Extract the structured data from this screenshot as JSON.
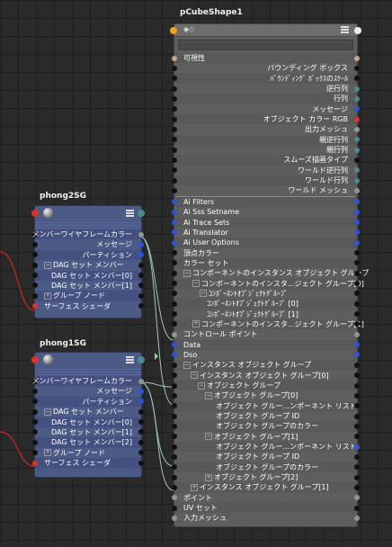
{
  "pcube": {
    "title": "pCubeShape1",
    "rows": [
      {
        "label": "可視性",
        "align": "l",
        "lp": "tan",
        "rp": "tan",
        "band": true
      },
      {
        "label": "バウンディング ボックス",
        "align": "r",
        "lp": "",
        "rp": "",
        "band": false
      },
      {
        "label": "ﾊﾞｳﾝﾃﾞｨﾝｸﾞ ﾎﾞｯｸｽのｽｹｰﾙ",
        "align": "r",
        "lp": "",
        "rp": "",
        "band": true
      },
      {
        "label": "逆行列",
        "align": "r",
        "lp": "",
        "rp": "teal",
        "band": false
      },
      {
        "label": "行列",
        "align": "r",
        "lp": "",
        "rp": "teal",
        "band": true
      },
      {
        "label": "メッセージ",
        "align": "r",
        "lp": "",
        "rp": "blue",
        "band": false
      },
      {
        "label": "オブジェクト カラー RGB",
        "align": "r",
        "lp": "",
        "rp": "red",
        "band": true
      },
      {
        "label": "出力メッシュ",
        "align": "r",
        "lp": "",
        "rp": "gray",
        "band": false
      },
      {
        "label": "親逆行列",
        "align": "r",
        "lp": "",
        "rp": "teal",
        "band": true
      },
      {
        "label": "親行列",
        "align": "r",
        "lp": "",
        "rp": "teal",
        "band": false
      },
      {
        "label": "スムーズ描画タイプ",
        "align": "r",
        "lp": "",
        "rp": "",
        "band": true
      },
      {
        "label": "ワールド逆行列",
        "align": "r",
        "lp": "",
        "rp": "teal",
        "band": false
      },
      {
        "label": "ワールド行列",
        "align": "r",
        "lp": "",
        "rp": "teal",
        "band": true
      },
      {
        "label": "ワールド メッシュ",
        "align": "r",
        "lp": "",
        "rp": "gray",
        "band": false
      },
      {
        "label": "Ai Filters",
        "align": "l",
        "lp": "blue",
        "rp": "blue",
        "band": true,
        "sep": true
      },
      {
        "label": "Ai Sss Setname",
        "align": "l",
        "lp": "blue",
        "rp": "blue",
        "band": false
      },
      {
        "label": "Ai Trace Sets",
        "align": "l",
        "lp": "blue",
        "rp": "blue",
        "band": true
      },
      {
        "label": "Ai Translator",
        "align": "l",
        "lp": "blue",
        "rp": "blue",
        "band": false
      },
      {
        "label": "Ai User Options",
        "align": "l",
        "lp": "blue",
        "rp": "blue",
        "band": true
      },
      {
        "label": "頂点カラー",
        "align": "l",
        "lp": "",
        "rp": "",
        "band": false
      },
      {
        "label": "カラー セット",
        "align": "l",
        "lp": "",
        "rp": "",
        "band": true
      },
      {
        "label": "コンポーネントのインスタンス オブジェクト グループ",
        "align": "l",
        "lp": "",
        "rp": "",
        "band": false,
        "tog": "⊟"
      },
      {
        "label": "コンポーネントのインスタ...ジェクト グループ[0]",
        "align": "l",
        "lp": "",
        "rp": "",
        "band": true,
        "tog": "⊟",
        "ind": 10
      },
      {
        "label": "ｺﾝﾎﾟｰﾈﾝﾄｵﾌﾞｼﾞｪｸﾄｸﾞﾙｰﾌﾟ",
        "align": "l",
        "lp": "",
        "rp": "",
        "band": false,
        "tog": "⊟",
        "ind": 18
      },
      {
        "label": "ｺﾝﾎﾟｰﾈﾝﾄｵﾌﾞｼﾞｪｸﾄｸﾞﾙｰﾌﾟ [0]",
        "align": "l",
        "lp": "",
        "rp": "",
        "band": true,
        "ind": 26
      },
      {
        "label": "ｺﾝﾎﾟｰﾈﾝﾄｵﾌﾞｼﾞｪｸﾄｸﾞﾙｰﾌﾟ [1]",
        "align": "l",
        "lp": "",
        "rp": "",
        "band": false,
        "ind": 26
      },
      {
        "label": "コンポーネントのインスタ...ジェクト グループ[1]",
        "align": "l",
        "lp": "",
        "rp": "",
        "band": true,
        "tog": "⊞",
        "ind": 10
      },
      {
        "label": "コントロール ポイント",
        "align": "l",
        "lp": "gray",
        "rp": "gray",
        "band": false
      },
      {
        "label": "Data",
        "align": "l",
        "lp": "blue",
        "rp": "blue",
        "band": true
      },
      {
        "label": "Dso",
        "align": "l",
        "lp": "blue",
        "rp": "blue",
        "band": false
      },
      {
        "label": "インスタンス オブジェクト グループ",
        "align": "l",
        "lp": "",
        "rp": "",
        "band": true,
        "tog": "⊟"
      },
      {
        "label": "インスタンス オブジェクト グループ[0]",
        "align": "l",
        "lp": "",
        "rp": "",
        "band": false,
        "tog": "⊟",
        "ind": 8
      },
      {
        "label": "オブジェクト グループ",
        "align": "l",
        "lp": "",
        "rp": "",
        "band": true,
        "tog": "⊟",
        "ind": 16
      },
      {
        "label": "オブジェクト グループ[0]",
        "align": "l",
        "lp": "",
        "rp": "",
        "band": false,
        "tog": "⊟",
        "ind": 24
      },
      {
        "label": "オブジェクト グルー...ンポーネント リスト",
        "align": "l",
        "lp": "",
        "rp": "",
        "band": true,
        "ind": 36
      },
      {
        "label": "オブジェクト グループ ID",
        "align": "l",
        "lp": "",
        "rp": "",
        "band": false,
        "ind": 36
      },
      {
        "label": "オブジェクト グループのカラー",
        "align": "l",
        "lp": "",
        "rp": "",
        "band": true,
        "ind": 36
      },
      {
        "label": "オブジェクト グループ[1]",
        "align": "l",
        "lp": "",
        "rp": "",
        "band": false,
        "tog": "⊟",
        "ind": 24
      },
      {
        "label": "オブジェクト グルー...ンポーネント リスト",
        "align": "l",
        "lp": "",
        "rp": "blue",
        "band": true,
        "ind": 36
      },
      {
        "label": "オブジェクト グループ ID",
        "align": "l",
        "lp": "",
        "rp": "",
        "band": false,
        "ind": 36
      },
      {
        "label": "オブジェクト グループのカラー",
        "align": "l",
        "lp": "",
        "rp": "",
        "band": true,
        "ind": 36
      },
      {
        "label": "オブジェクト グループ[2]",
        "align": "l",
        "lp": "",
        "rp": "",
        "band": false,
        "tog": "⊞",
        "ind": 24
      },
      {
        "label": "インスタンス オブジェクト グループ[1]",
        "align": "l",
        "lp": "",
        "rp": "",
        "band": true,
        "tog": "⊞",
        "ind": 8
      },
      {
        "label": "ポイント",
        "align": "l",
        "lp": "gray",
        "rp": "gray",
        "band": false
      },
      {
        "label": "UV セット",
        "align": "l",
        "lp": "",
        "rp": "",
        "band": true
      },
      {
        "label": "入力メッシュ",
        "align": "l",
        "lp": "gray",
        "rp": "gray",
        "band": false
      }
    ]
  },
  "phong2": {
    "title": "phong2SG",
    "rows": [
      {
        "label": "メンバーワイヤフレームカラー",
        "align": "r",
        "lp": "",
        "rp": "gray",
        "band": true
      },
      {
        "label": "メッセージ",
        "align": "r",
        "lp": "",
        "rp": "blue",
        "band": false
      },
      {
        "label": "パーティション",
        "align": "r",
        "lp": "",
        "rp": "blue",
        "band": true
      },
      {
        "label": "DAG セット メンバー",
        "align": "l",
        "lp": "",
        "rp": "",
        "band": false,
        "tog": "⊟"
      },
      {
        "label": "DAG セット メンバー[0]",
        "align": "l",
        "lp": "",
        "rp": "",
        "band": true,
        "ind": 8
      },
      {
        "label": "DAG セット メンバー[1]",
        "align": "l",
        "lp": "",
        "rp": "",
        "band": false,
        "ind": 8
      },
      {
        "label": "グループ ノード",
        "align": "l",
        "lp": "",
        "rp": "",
        "band": true,
        "tog": "⊞"
      },
      {
        "label": "サーフェス シェーダ",
        "align": "l",
        "lp": "red",
        "rp": "",
        "band": false
      }
    ]
  },
  "phong1": {
    "title": "phong1SG",
    "rows": [
      {
        "label": "メンバーワイヤフレームカラー",
        "align": "r",
        "lp": "",
        "rp": "gray",
        "band": true
      },
      {
        "label": "メッセージ",
        "align": "r",
        "lp": "",
        "rp": "blue",
        "band": false
      },
      {
        "label": "パーティション",
        "align": "r",
        "lp": "",
        "rp": "blue",
        "band": true
      },
      {
        "label": "DAG セット メンバー",
        "align": "l",
        "lp": "",
        "rp": "",
        "band": false,
        "tog": "⊟"
      },
      {
        "label": "DAG セット メンバー[0]",
        "align": "l",
        "lp": "",
        "rp": "",
        "band": true,
        "ind": 8
      },
      {
        "label": "DAG セット メンバー[1]",
        "align": "l",
        "lp": "",
        "rp": "",
        "band": false,
        "ind": 8
      },
      {
        "label": "DAG セット メンバー[2]",
        "align": "l",
        "lp": "",
        "rp": "",
        "band": true,
        "ind": 8
      },
      {
        "label": "グループ ノード",
        "align": "l",
        "lp": "",
        "rp": "",
        "band": false,
        "tog": "⊞"
      },
      {
        "label": "サーフェス シェーダ",
        "align": "l",
        "lp": "red",
        "rp": "",
        "band": true
      }
    ]
  },
  "icons": {
    "node_menu": "menu-icon",
    "shader_ball": "shader-ball-icon",
    "header_dots": "drag-handle-icon"
  },
  "colors": {
    "blue_port": "#2e53d8",
    "gray_port": "#8c9a8c",
    "teal_port": "#4b8a8f",
    "red_port": "#d9342b",
    "tan_port": "#c9a38b",
    "wire_green": "#9fc9b5",
    "wire_red": "#c8282a"
  }
}
